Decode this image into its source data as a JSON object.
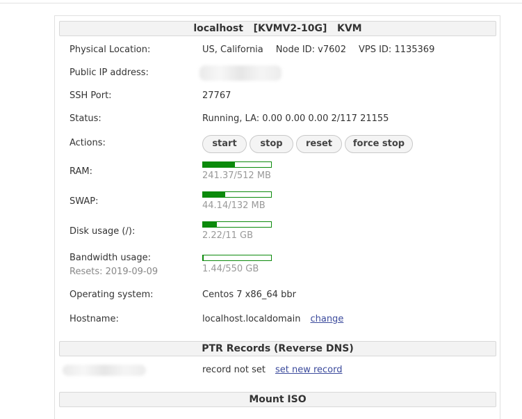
{
  "header": {
    "hostname": "localhost",
    "plan": "[KVMV2-10G]",
    "virt": "KVM"
  },
  "info": {
    "location": {
      "label": "Physical Location:",
      "value": "US, California",
      "node": "Node ID: v7602",
      "vps": "VPS ID: 1135369"
    },
    "ip": {
      "label": "Public IP address:"
    },
    "ssh": {
      "label": "SSH Port:",
      "value": "27767"
    },
    "status": {
      "label": "Status:",
      "value": "Running, LA: 0.00 0.00 0.00 2/117 21155"
    },
    "actions": {
      "label": "Actions:",
      "start": "start",
      "stop": "stop",
      "reset": "reset",
      "force_stop": "force stop"
    },
    "ram": {
      "label": "RAM:",
      "text": "241.37/512 MB",
      "fraction": 0.47
    },
    "swap": {
      "label": "SWAP:",
      "text": "44.14/132 MB",
      "fraction": 0.33
    },
    "disk": {
      "label": "Disk usage (/):",
      "text": "2.22/11 GB",
      "fraction": 0.2
    },
    "bandwidth": {
      "label": "Bandwidth usage:",
      "resets": "Resets: 2019-09-09",
      "text": "1.44/550 GB",
      "fraction": 0.003
    },
    "os": {
      "label": "Operating system:",
      "value": "Centos 7 x86_64 bbr"
    },
    "hostname": {
      "label": "Hostname:",
      "value": "localhost.localdomain",
      "change": "change"
    }
  },
  "ptr": {
    "title": "PTR Records (Reverse DNS)",
    "status": "record not set",
    "link": "set new record"
  },
  "mount": {
    "title": "Mount ISO"
  },
  "colors": {
    "bar": "#0b8a0b",
    "link": "#3b4a9c"
  }
}
